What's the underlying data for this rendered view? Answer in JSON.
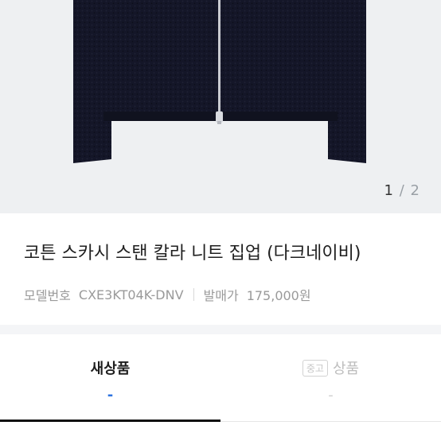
{
  "gallery": {
    "current": "1",
    "separator": "/",
    "total": "2"
  },
  "product": {
    "title": "코튼 스카시 스탠 칼라 니트 집업 (다크네이비)",
    "model_label": "모델번호",
    "model_value": "CXE3KT04K-DNV",
    "price_label": "발매가",
    "price_value": "175,000원"
  },
  "tabs": [
    {
      "label": "새상품",
      "price": "-",
      "active": true
    },
    {
      "badge": "중고",
      "label": "상품",
      "price": "-",
      "active": false
    }
  ],
  "colors": {
    "accent_blue": "#2f74e0",
    "active_underline": "#111111",
    "gallery_bg": "#eef0f2",
    "knit_navy": "#141628"
  }
}
